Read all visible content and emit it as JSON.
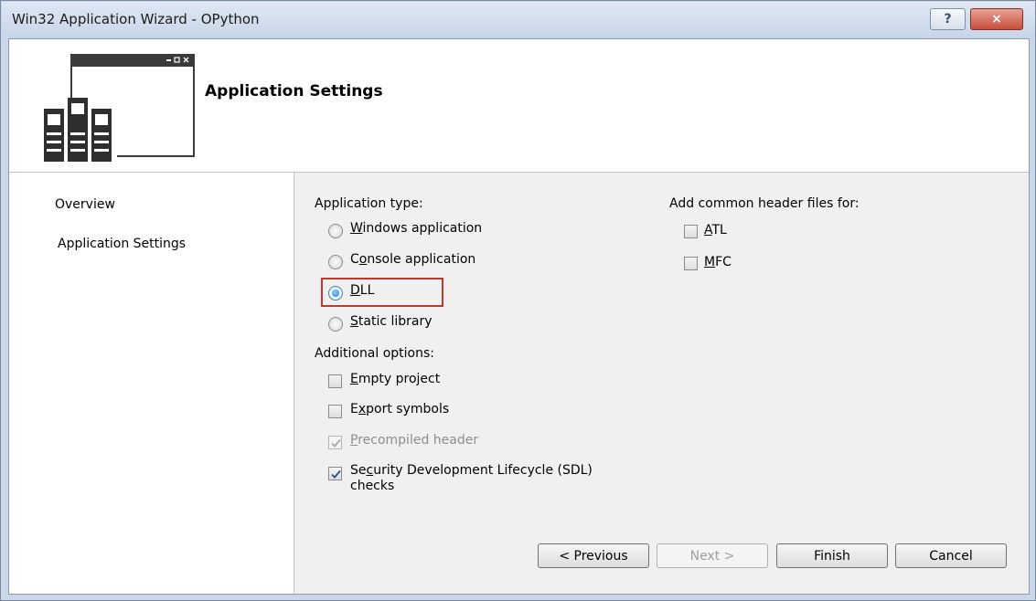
{
  "window": {
    "title": "Win32 Application Wizard - OPython",
    "help_glyph": "?",
    "close_glyph": "×"
  },
  "banner": {
    "title": "Application Settings"
  },
  "nav": {
    "items": [
      {
        "label": "Overview"
      },
      {
        "label": "Application Settings"
      }
    ]
  },
  "application_type": {
    "label": "Application type:",
    "options": [
      {
        "label": "Windows application",
        "accel": "W",
        "rest": "indows application",
        "checked": false
      },
      {
        "label": "Console application",
        "accel": "o",
        "pre": "C",
        "rest": "nsole application",
        "checked": false
      },
      {
        "label": "DLL",
        "accel": "D",
        "rest": "LL",
        "checked": true
      },
      {
        "label": "Static library",
        "accel": "S",
        "rest": "tatic library",
        "checked": false
      }
    ]
  },
  "additional_options": {
    "label": "Additional options:",
    "options": [
      {
        "pre": "",
        "accel": "E",
        "rest": "mpty project",
        "checked": false,
        "disabled": false
      },
      {
        "pre": "E",
        "accel": "x",
        "rest": "port symbols",
        "checked": false,
        "disabled": false
      },
      {
        "pre": "",
        "accel": "P",
        "rest": "recompiled header",
        "checked": true,
        "disabled": true
      },
      {
        "pre": "Se",
        "accel": "c",
        "rest": "urity Development Lifecycle (SDL)",
        "line2": "checks",
        "checked": true,
        "disabled": false
      }
    ]
  },
  "header_files": {
    "label": "Add common header files for:",
    "options": [
      {
        "accel": "A",
        "rest": "TL",
        "checked": false
      },
      {
        "accel": "M",
        "rest": "FC",
        "checked": false
      }
    ]
  },
  "buttons": {
    "previous": "< Previous",
    "next": "Next >",
    "finish": "Finish",
    "cancel": "Cancel"
  },
  "colors": {
    "highlight": "#c0392b",
    "close_button": "#c74d3a"
  }
}
